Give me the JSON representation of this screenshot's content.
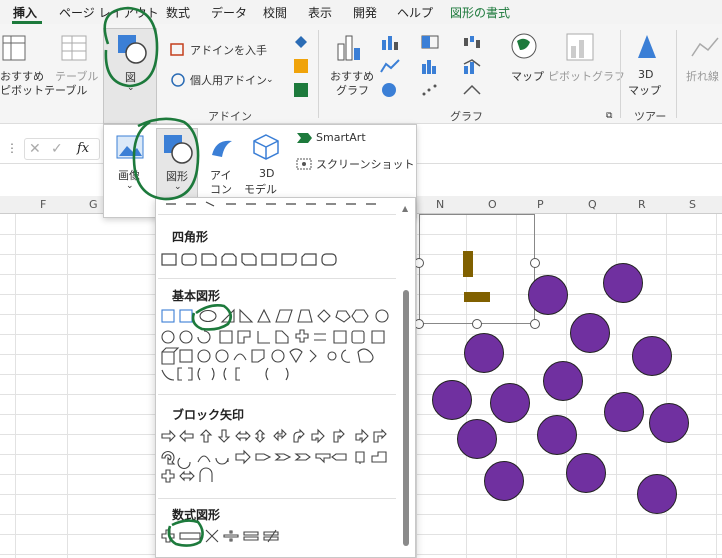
{
  "tabs": [
    {
      "label": "挿入",
      "active": true
    },
    {
      "label": "ページ レイアウト"
    },
    {
      "label": "数式"
    },
    {
      "label": "データ"
    },
    {
      "label": "校閲"
    },
    {
      "label": "表示"
    },
    {
      "label": "開発"
    },
    {
      "label": "ヘルプ"
    },
    {
      "label": "図形の書式",
      "contextual": true
    }
  ],
  "ribbon": {
    "recommended_table_1": "おすすめ",
    "recommended_table_2": "ピボットテーブル",
    "table": "テーブル",
    "group_table": "テーブル",
    "figure": "図",
    "get_addins": "アドインを入手",
    "personal_addins": "個人用アドイン",
    "group_addins": "アドイン",
    "recommended_chart_1": "おすすめ",
    "recommended_chart_2": "グラフ",
    "map": "マップ",
    "pivot_chart": "ピボットグラフ",
    "group_chart": "グラフ",
    "map3d_1": "3D",
    "map3d_2": "マップ",
    "group_tour": "ツアー",
    "line": "折れ線"
  },
  "illustrations": {
    "image": "画像",
    "shapes": "図形",
    "icons_1": "アイ",
    "icons_2": "コン",
    "model3d_1": "3D",
    "model3d_2": "モデル",
    "smartart": "SmartArt",
    "screenshot": "スクリーンショット"
  },
  "formula_bar": {
    "fx": "fx"
  },
  "columns": [
    "F",
    "G",
    "N",
    "O",
    "P",
    "Q",
    "R",
    "S"
  ],
  "gallery": {
    "rectangles": "四角形",
    "basic_shapes": "基本図形",
    "block_arrows": "ブロック矢印",
    "equation_shapes": "数式図形"
  },
  "colors": {
    "accent": "#1d7a3c",
    "circle": "#7030a0",
    "rect": "#806000"
  }
}
